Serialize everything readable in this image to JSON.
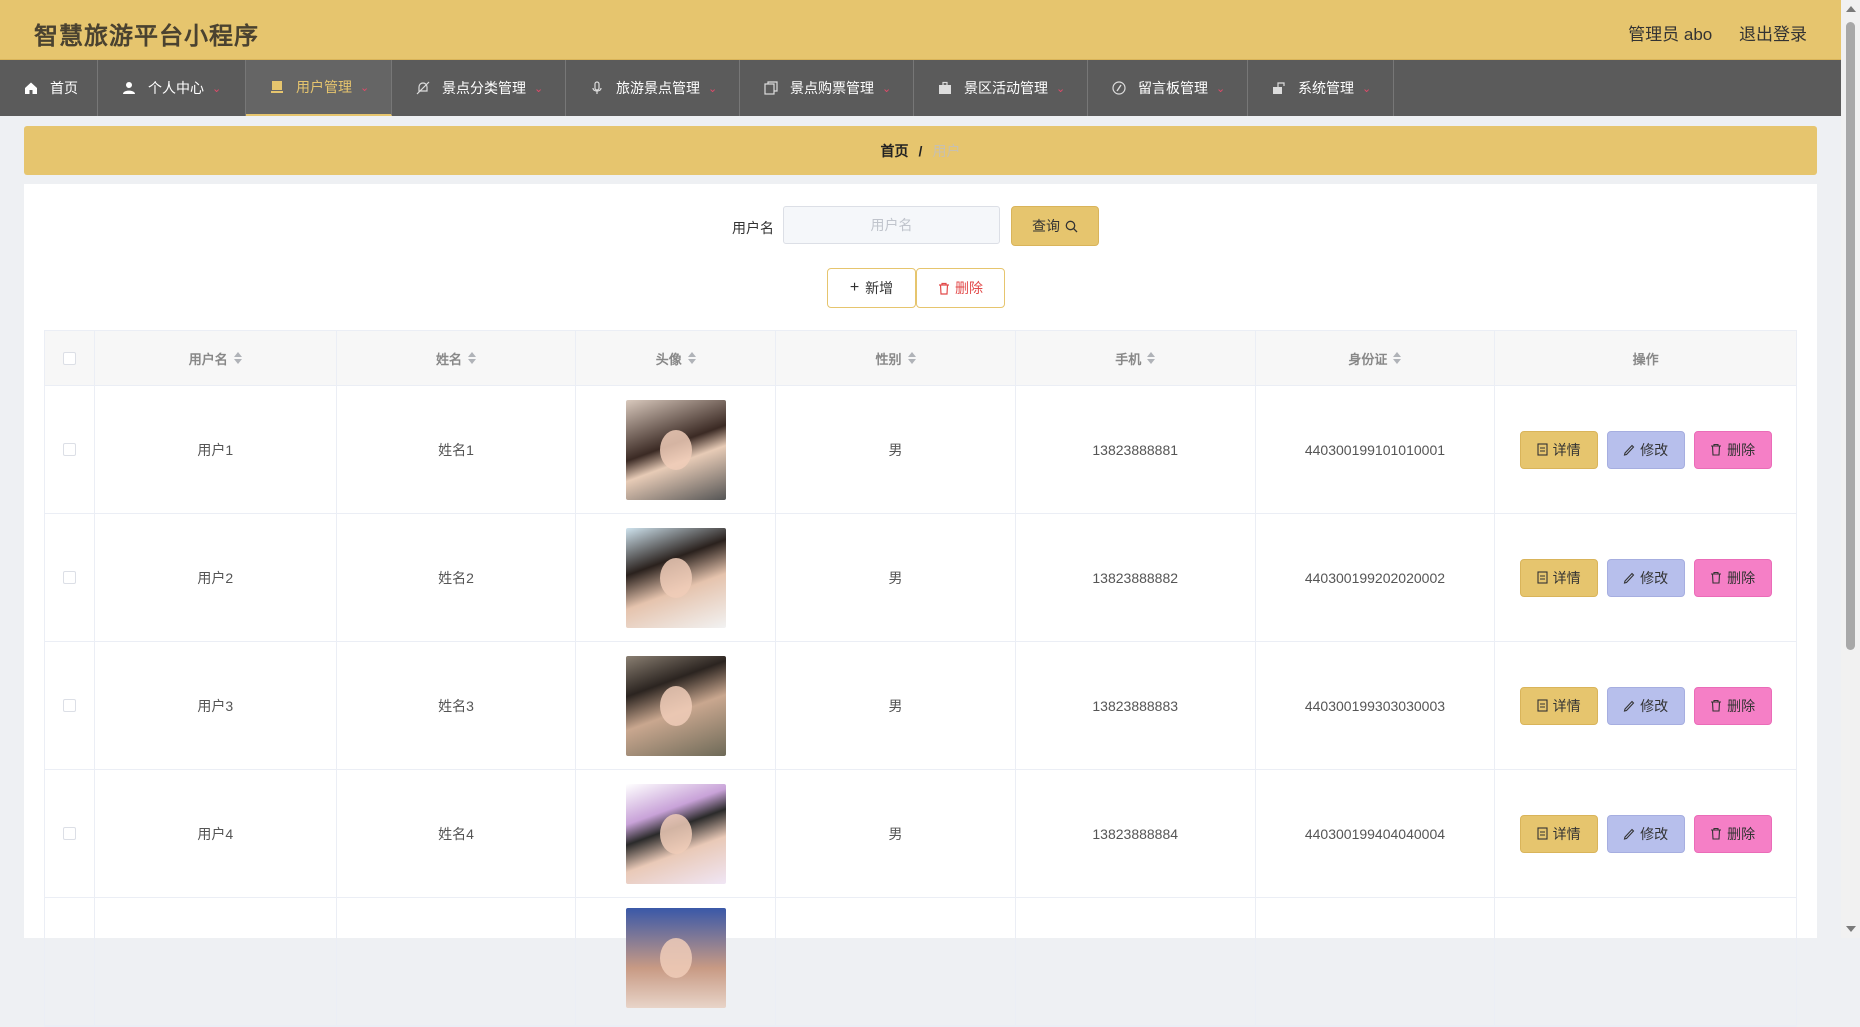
{
  "header": {
    "title": "智慧旅游平台小程序",
    "admin_label": "管理员 abo",
    "logout": "退出登录"
  },
  "nav": {
    "items": [
      {
        "label": "首页",
        "icon": "home-icon"
      },
      {
        "label": "个人中心",
        "icon": "user-icon"
      },
      {
        "label": "用户管理",
        "icon": "user-card-icon",
        "active": true
      },
      {
        "label": "景点分类管理",
        "icon": "bell-off-icon"
      },
      {
        "label": "旅游景点管理",
        "icon": "microphone-icon"
      },
      {
        "label": "景点购票管理",
        "icon": "copy-icon"
      },
      {
        "label": "景区活动管理",
        "icon": "briefcase-icon"
      },
      {
        "label": "留言板管理",
        "icon": "compass-icon"
      },
      {
        "label": "系统管理",
        "icon": "mailbox-icon"
      }
    ]
  },
  "breadcrumb": {
    "home": "首页",
    "separator": "/",
    "current": "用户"
  },
  "search": {
    "label": "用户名",
    "placeholder": "用户名",
    "value": "",
    "query_button": "查询"
  },
  "actions": {
    "add": "新增",
    "delete": "删除"
  },
  "table": {
    "headers": [
      "用户名",
      "姓名",
      "头像",
      "性别",
      "手机",
      "身份证",
      "操作"
    ],
    "rows": [
      {
        "username": "用户1",
        "name": "姓名1",
        "gender": "男",
        "phone": "13823888881",
        "id_card": "440300199101010001"
      },
      {
        "username": "用户2",
        "name": "姓名2",
        "gender": "男",
        "phone": "13823888882",
        "id_card": "440300199202020002"
      },
      {
        "username": "用户3",
        "name": "姓名3",
        "gender": "男",
        "phone": "13823888883",
        "id_card": "440300199303030003"
      },
      {
        "username": "用户4",
        "name": "姓名4",
        "gender": "男",
        "phone": "13823888884",
        "id_card": "440300199404040004"
      }
    ],
    "row_buttons": {
      "detail": "详情",
      "edit": "修改",
      "delete": "删除"
    }
  },
  "colors": {
    "accent": "#e6c56e",
    "nav_bg": "#5b5b5b",
    "edit_button": "#b7bfec",
    "delete_button": "#f57fc6",
    "danger_text": "#e24a4a"
  }
}
